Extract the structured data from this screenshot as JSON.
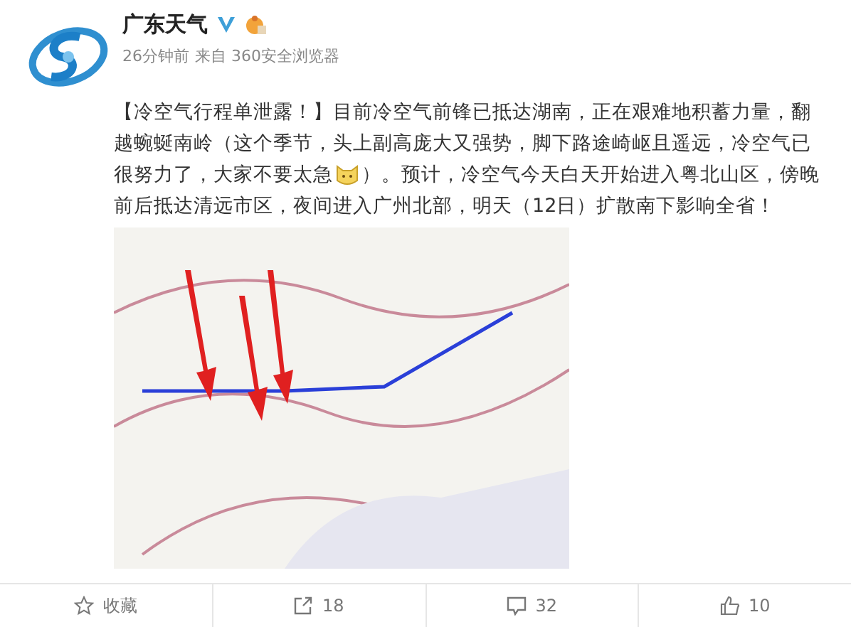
{
  "account": {
    "name": "广东天气",
    "verified": true
  },
  "meta": [
    "26分钟前",
    "来自 360安全浏览器"
  ],
  "post": {
    "lines": [
      [
        "【冷空气行程单泄露！】目前冷空气前锋已抵达湖南，正在艰难地积蓄力量，翻"
      ],
      [
        "越蜿蜒南岭（这个季节，头上副高庞大又强势，脚下路途崎岖且遥远，冷空气已"
      ],
      [
        "很努力了，大家不要太急",
        "）。预计，冷空气今天白天开始进入粤北山区，傍晚"
      ],
      [
        "前后抵达清远市区，夜间进入广州北部，明天（12日）扩散南下影响全省！"
      ]
    ],
    "image": {
      "kind": "picture"
    }
  },
  "actions": [
    {
      "label": "收藏",
      "kind": "favorite"
    },
    {
      "label": "18",
      "kind": "repost"
    },
    {
      "label": "32",
      "kind": "comment"
    },
    {
      "label": "10",
      "kind": "like"
    }
  ]
}
